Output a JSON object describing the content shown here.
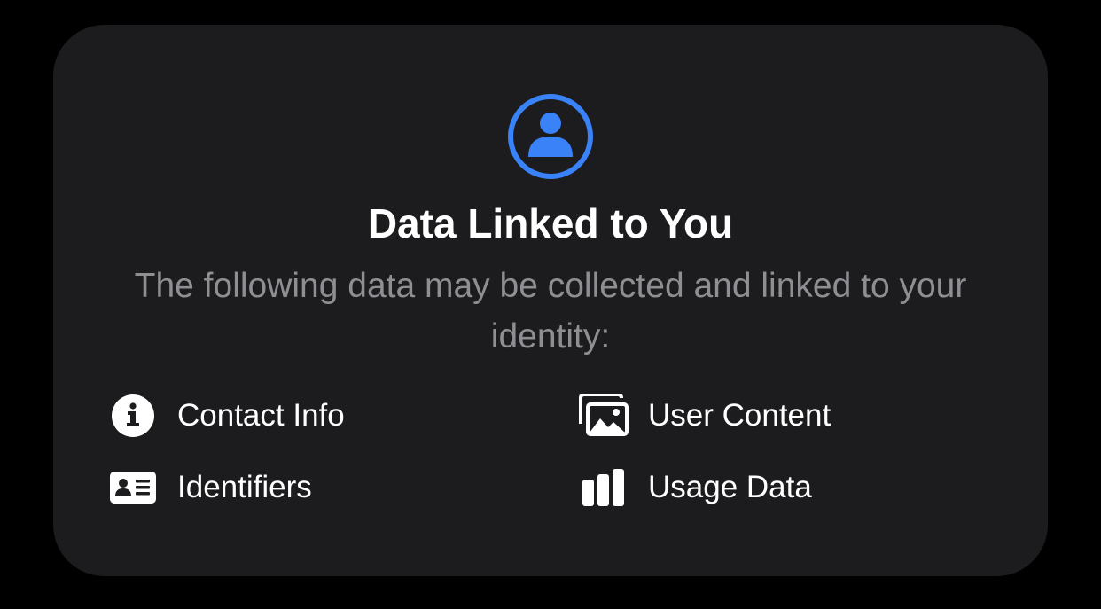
{
  "header": {
    "icon": "person-circle-icon",
    "title": "Data Linked to You",
    "subtitle": "The following data may be collected and linked to your identity:"
  },
  "categories": [
    {
      "label": "Contact Info",
      "icon": "info-circle-icon"
    },
    {
      "label": "User Content",
      "icon": "photos-icon"
    },
    {
      "label": "Identifiers",
      "icon": "id-card-icon"
    },
    {
      "label": "Usage Data",
      "icon": "bar-chart-icon"
    }
  ],
  "colors": {
    "background": "#000000",
    "card": "#1c1c1e",
    "accent": "#3a82f7",
    "title": "#ffffff",
    "subtitle": "#8e8e93"
  }
}
